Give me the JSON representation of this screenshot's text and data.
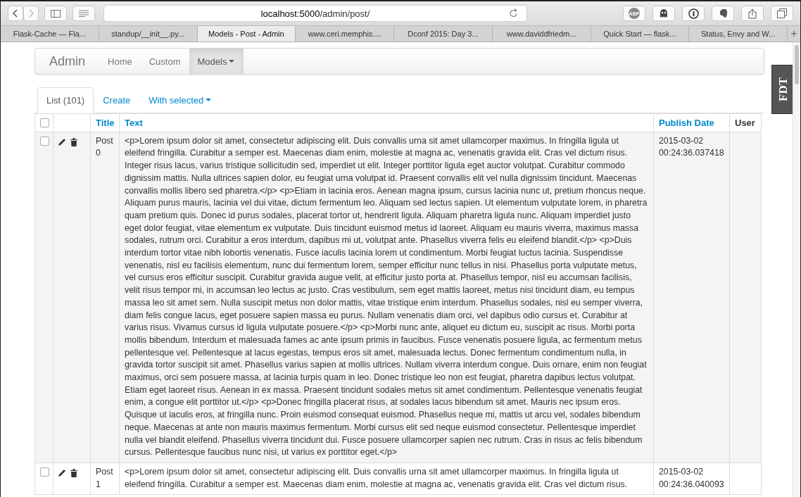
{
  "browser": {
    "address_host": "localhost:5000",
    "address_path": "/admin/post/",
    "adblock_badge": "ABP",
    "tabs": [
      {
        "label": "Flask-Cache — Fla...",
        "selected": false
      },
      {
        "label": "standup/__init__.py...",
        "selected": false
      },
      {
        "label": "Models - Post - Admin",
        "selected": true
      },
      {
        "label": "www.ceri.memphis....",
        "selected": false
      },
      {
        "label": "Dconf 2015: Day 3...",
        "selected": false
      },
      {
        "label": "www.daviddfriedm...",
        "selected": false
      },
      {
        "label": "Quick Start — flask...",
        "selected": false
      },
      {
        "label": "Status, Envy and W...",
        "selected": false
      }
    ],
    "new_tab": "+"
  },
  "navbar": {
    "brand": "Admin",
    "items": [
      {
        "label": "Home",
        "selected": false,
        "dropdown": false
      },
      {
        "label": "Custom",
        "selected": false,
        "dropdown": false
      },
      {
        "label": "Models",
        "selected": true,
        "dropdown": true
      }
    ]
  },
  "list_tabs": [
    {
      "label": "List (101)",
      "selected": true,
      "dropdown": false
    },
    {
      "label": "Create",
      "selected": false,
      "dropdown": false
    },
    {
      "label": "With selected",
      "selected": false,
      "dropdown": true
    }
  ],
  "table": {
    "select_all_checked": false,
    "columns": [
      {
        "label": "Title",
        "sortable": true
      },
      {
        "label": "Text",
        "sortable": true
      },
      {
        "label": "Publish Date",
        "sortable": true
      },
      {
        "label": "User",
        "sortable": false
      }
    ],
    "rows": [
      {
        "checked": false,
        "title": "Post 0",
        "text": "<p>Lorem ipsum dolor sit amet, consectetur adipiscing elit. Duis convallis urna sit amet ullamcorper maximus. In fringilla ligula ut eleifend fringilla. Curabitur a semper est. Maecenas diam enim, molestie at magna ac, venenatis gravida elit. Cras vel dictum risus. Integer risus lacus, varius tristique sollicitudin sed, imperdiet ut elit. Integer porttitor ligula eget auctor volutpat. Curabitur commodo dignissim mattis. Nulla ultrices sapien dolor, eu feugiat urna volutpat id. Praesent convallis elit vel nulla dignissim tincidunt. Maecenas convallis mollis libero sed pharetra.</p> <p>Etiam in lacinia eros. Aenean magna ipsum, cursus lacinia nunc ut, pretium rhoncus neque. Aliquam purus mauris, lacinia vel dui vitae, dictum fermentum leo. Aliquam sed lectus sapien. Ut elementum vulputate lorem, in pharetra quam pretium quis. Donec id purus sodales, placerat tortor ut, hendrerit ligula. Aliquam pharetra ligula nunc. Aliquam imperdiet justo eget dolor feugiat, vitae elementum ex vulputate. Duis tincidunt euismod metus id laoreet. Aliquam eu mauris viverra, maximus massa sodales, rutrum orci. Curabitur a eros interdum, dapibus mi ut, volutpat ante. Phasellus viverra felis eu eleifend blandit.</p> <p>Duis interdum tortor vitae nibh lobortis venenatis. Fusce iaculis lacinia lorem ut condimentum. Morbi feugiat luctus lacinia. Suspendisse venenatis, nisl eu facilisis elementum, nunc dui fermentum lorem, semper efficitur nunc tellus in nisi. Phasellus porta vulputate metus, vel cursus eros efficitur suscipit. Curabitur gravida augue velit, at efficitur justo porta at. Phasellus tempor, nisl eu accumsan facilisis, velit risus tempor mi, in accumsan leo lectus ac justo. Cras vestibulum, sem eget mattis laoreet, metus nisi tincidunt diam, eu tempus massa leo sit amet sem. Nulla suscipit metus non dolor mattis, vitae tristique enim interdum. Phasellus sodales, nisl eu semper viverra, diam felis congue lacus, eget posuere sapien massa eu purus. Nullam venenatis diam orci, vel dapibus odio cursus et. Curabitur at varius risus. Vivamus cursus id ligula vulputate posuere.</p> <p>Morbi nunc ante, aliquet eu dictum eu, suscipit ac risus. Morbi porta mollis bibendum. Interdum et malesuada fames ac ante ipsum primis in faucibus. Fusce venenatis posuere ligula, ac fermentum metus pellentesque vel. Pellentesque at lacus egestas, tempus eros sit amet, malesuada lectus. Donec fermentum condimentum nulla, in gravida tortor suscipit sit amet. Phasellus varius sapien at mollis ultrices. Nullam viverra interdum congue. Duis ornare, enim non feugiat maximus, orci sem posuere massa, at lacinia turpis quam in leo. Donec tristique leo non est feugiat, pharetra dapibus lectus volutpat. Etiam eget laoreet risus. Aenean in ex massa. Praesent tincidunt sodales metus sit amet condimentum. Pellentesque venenatis feugiat enim, a congue elit porttitor ut.</p> <p>Donec fringilla placerat risus, at sodales lacus bibendum sit amet. Mauris nec ipsum eros. Quisque ut iaculis eros, at fringilla nunc. Proin euismod consequat euismod. Phasellus neque mi, mattis ut arcu vel, sodales bibendum neque. Maecenas at ante non mauris maximus fermentum. Morbi cursus elit sed neque euismod consectetur. Pellentesque imperdiet nulla vel blandit eleifend. Phasellus viverra tincidunt dui. Fusce posuere ullamcorper sapien nec rutrum. Cras in risus ac felis bibendum cursus. Pellentesque faucibus nunc nisi, ut varius ex porttitor eget.</p>",
        "publish_date": "2015-03-02 00:24:36.037418"
      },
      {
        "checked": false,
        "title": "Post 1",
        "text": "<p>Lorem ipsum dolor sit amet, consectetur adipiscing elit. Duis convallis urna sit amet ullamcorper maximus. In fringilla ligula ut eleifend fringilla. Curabitur a semper est. Maecenas diam enim, molestie at magna ac, venenatis gravida elit. Cras vel dictum risus.",
        "publish_date": "2015-03-02 00:24:36.040093"
      }
    ]
  },
  "debug_toolbar_handle": "FDT"
}
